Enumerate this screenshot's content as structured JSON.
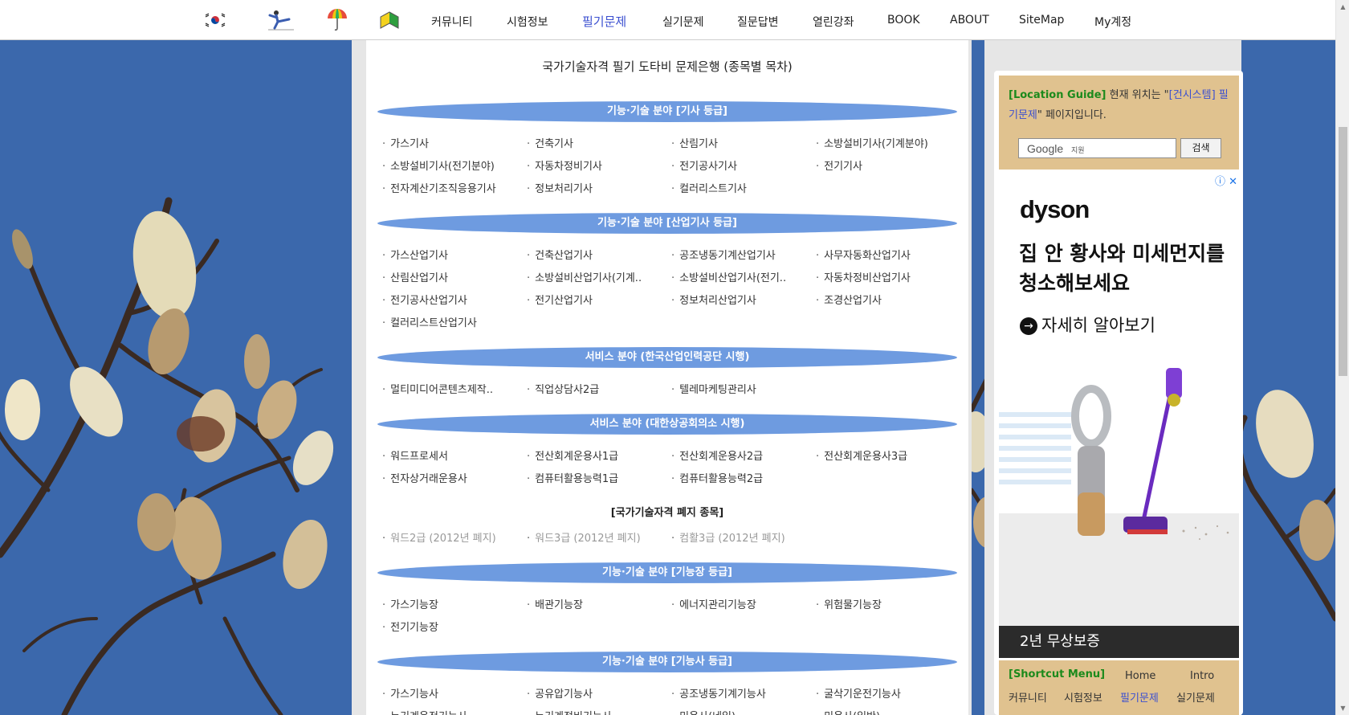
{
  "nav": {
    "icons": [
      {
        "name": "korea-flag-icon"
      },
      {
        "name": "taekwondo-icon"
      },
      {
        "name": "umbrella-icon"
      },
      {
        "name": "beginner-mark-icon"
      }
    ],
    "links": [
      "커뮤니티",
      "시험정보",
      "필기문제",
      "실기문제",
      "질문답변",
      "열린강좌",
      "BOOK",
      "ABOUT",
      "SiteMap",
      "My계정"
    ],
    "active_index": 2,
    "active_color": "#3b4fd0"
  },
  "main": {
    "title": "국가기술자격 필기 도타비 문제은행 (종목별 목차)",
    "sections": [
      {
        "band": "기능·기술 분야 [기사 등급]",
        "items": [
          "가스기사",
          "건축기사",
          "산림기사",
          "소방설비기사(기계분야)",
          "소방설비기사(전기분야)",
          "자동차정비기사",
          "전기공사기사",
          "전기기사",
          "전자계산기조직응용기사",
          "정보처리기사",
          "컬러리스트기사"
        ]
      },
      {
        "band": "기능·기술 분야 [산업기사 등급]",
        "items": [
          "가스산업기사",
          "건축산업기사",
          "공조냉동기계산업기사",
          "사무자동화산업기사",
          "산림산업기사",
          "소방설비산업기사(기계..",
          "소방설비산업기사(전기..",
          "자동차정비산업기사",
          "전기공사산업기사",
          "전기산업기사",
          "정보처리산업기사",
          "조경산업기사",
          "컬러리스트산업기사"
        ]
      },
      {
        "band": "서비스 분야 (한국산업인력공단 시행)",
        "items": [
          "멀티미디어콘텐츠제작..",
          "직업상담사2급",
          "텔레마케팅관리사"
        ]
      },
      {
        "band": "서비스 분야 (대한상공회의소 시행)",
        "items": [
          "워드프로세서",
          "전산회계운용사1급",
          "전산회계운용사2급",
          "전산회계운용사3급",
          "전자상거래운용사",
          "컴퓨터활용능력1급",
          "컴퓨터활용능력2급"
        ]
      },
      {
        "note": "[국가기술자격 폐지 종목]",
        "disabled_items": [
          "워드2급 (2012년 폐지)",
          "워드3급 (2012년 폐지)",
          "컴활3급 (2012년 폐지)"
        ]
      },
      {
        "band": "기능·기술 분야 [기능장 등급]",
        "items": [
          "가스기능장",
          "배관기능장",
          "에너지관리기능장",
          "위험물기능장",
          "전기기능장"
        ]
      },
      {
        "band": "기능·기술 분야 [기능사 등급]",
        "items": [
          "가스기능사",
          "공유압기능사",
          "공조냉동기계기능사",
          "굴삭기운전기능사",
          "누기계운전기능사",
          "누기계정비기능사",
          "미용사(네일)",
          "미용사(일반)"
        ]
      }
    ],
    "band_color": "#6e9be0"
  },
  "sidebar": {
    "location_label": "[Location Guide]",
    "location_prefix": "현재 위치는 \"",
    "location_link": "[건시스템] 필기문제",
    "location_suffix": "\" 페이지입니다.",
    "search_brand": "Google",
    "search_sub": "지원",
    "search_button": "검색",
    "ad": {
      "icons": "ⓘ ✕",
      "brand": "dyson",
      "headline": "집 안 황사와 미세먼지를 청소해보세요",
      "cta": "자세히 알아보기",
      "cta_icon": "→",
      "footer": "2년 무상보증"
    },
    "shortcut": {
      "label": "[Shortcut Menu]",
      "row1": [
        "Home",
        "Intro"
      ],
      "row2": [
        "커뮤니티",
        "시험정보",
        "필기문제",
        "실기문제"
      ],
      "active": "필기문제"
    },
    "panel_color": "#e0c28f"
  },
  "background_color": "#3b68ac"
}
